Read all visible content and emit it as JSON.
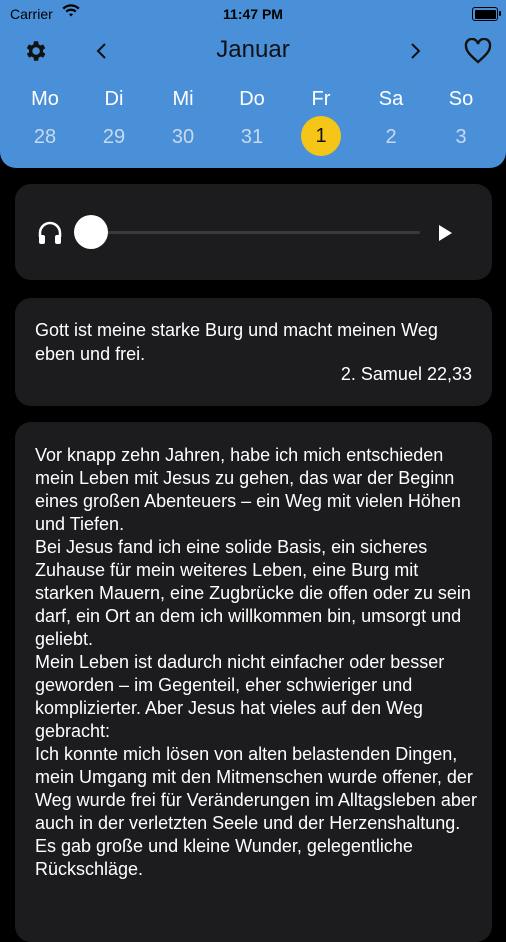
{
  "status_bar": {
    "carrier": "Carrier",
    "time": "11:47 PM"
  },
  "calendar": {
    "month": "Januar",
    "days": [
      {
        "name": "Mo",
        "num": "28"
      },
      {
        "name": "Di",
        "num": "29"
      },
      {
        "name": "Mi",
        "num": "30"
      },
      {
        "name": "Do",
        "num": "31"
      },
      {
        "name": "Fr",
        "num": "1"
      },
      {
        "name": "Sa",
        "num": "2"
      },
      {
        "name": "So",
        "num": "3"
      }
    ],
    "selected_index": 4,
    "accent": "#f5c518",
    "header_bg": "#4a90d9"
  },
  "player": {
    "progress": 0.0
  },
  "verse": {
    "text": "Gott ist meine starke Burg und macht meinen Weg eben und frei.",
    "reference": "2. Samuel 22,33"
  },
  "devotion": {
    "text": "Vor knapp zehn Jahren, habe ich mich entschieden mein Leben mit Jesus zu gehen, das war der Beginn eines großen Abenteuers – ein Weg mit vielen Höhen und Tiefen.\nBei Jesus fand ich eine solide Basis, ein sicheres Zuhause für mein weiteres Leben, eine Burg mit starken Mauern, eine Zugbrücke die offen oder zu sein darf, ein Ort an dem ich willkommen bin, umsorgt und geliebt.\nMein Leben ist dadurch nicht einfacher oder besser geworden – im Gegenteil, eher schwieriger und komplizierter. Aber Jesus hat vieles auf den Weg gebracht:\nIch konnte mich lösen von alten belastenden Dingen, mein Umgang mit den Mitmenschen wurde offener, der Weg wurde frei für Veränderungen im Alltagsleben aber auch in der verletzten Seele und der Herzenshaltung.\nEs gab große und kleine Wunder, gelegentliche Rückschläge."
  }
}
